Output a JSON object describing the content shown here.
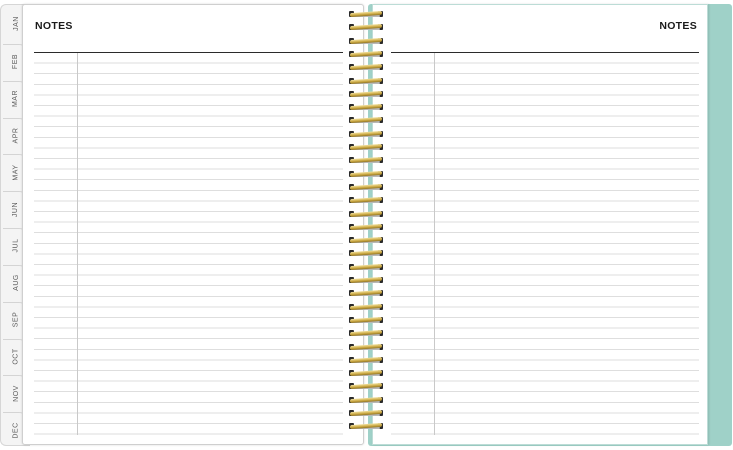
{
  "tabs": {
    "months": [
      "JAN",
      "FEB",
      "MAR",
      "APR",
      "MAY",
      "JUN",
      "JUL",
      "AUG",
      "SEP",
      "OCT",
      "NOV",
      "DEC"
    ]
  },
  "left_page": {
    "title": "NOTES"
  },
  "right_page": {
    "title": "NOTES"
  },
  "colors": {
    "cover": "#9fd1c8",
    "rule_lines": "#dedede",
    "spiral_wire": "#c9a640"
  }
}
